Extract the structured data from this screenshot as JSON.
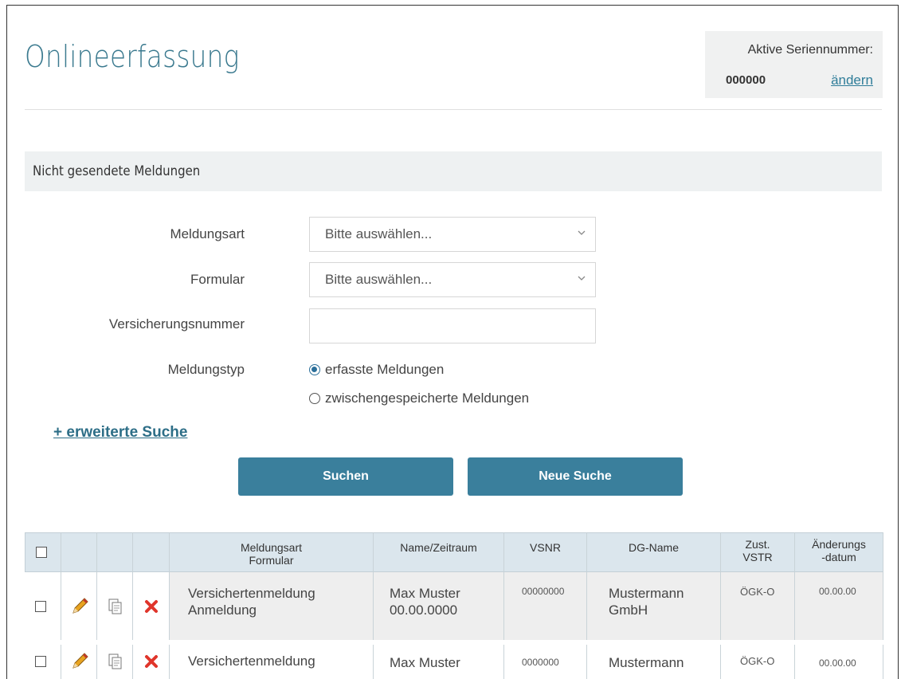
{
  "header": {
    "title": "Onlineerfassung",
    "serial_label": "Aktive Seriennummer:",
    "serial_value": "000000",
    "serial_change": "ändern"
  },
  "section": {
    "title": "Nicht gesendete Meldungen"
  },
  "form": {
    "meldungsart_label": "Meldungsart",
    "meldungsart_value": "Bitte auswählen...",
    "formular_label": "Formular",
    "formular_value": "Bitte auswählen...",
    "versicherungsnummer_label": "Versicherungsnummer",
    "versicherungsnummer_value": "",
    "meldungstyp_label": "Meldungstyp",
    "radio_options": [
      {
        "label": "erfasste Meldungen",
        "checked": true
      },
      {
        "label": "zwischengespeicherte Meldungen",
        "checked": false
      }
    ],
    "extended_search": "+ erweiterte Suche",
    "search_button": "Suchen",
    "new_search_button": "Neue Suche"
  },
  "table": {
    "columns": {
      "meldungsart_line1": "Meldungsart",
      "meldungsart_line2": "Formular",
      "name": "Name/Zeitraum",
      "vsnr": "VSNR",
      "dg_name": "DG-Name",
      "zust_line1": "Zust.",
      "zust_line2": "VSTR",
      "date_line1": "Änderungs",
      "date_line2": "-datum"
    },
    "rows": [
      {
        "meldungsart": "Versichertenmeldung",
        "formular": "Anmeldung",
        "name": "Max Muster",
        "zeitraum": "00.00.0000",
        "vsnr": "00000000",
        "dg_name_line1": "Mustermann",
        "dg_name_line2": "GmbH",
        "zust": "ÖGK-O",
        "datum": "00.00.00"
      },
      {
        "meldungsart": "Versichertenmeldung",
        "formular": "",
        "name": "Max Muster",
        "zeitraum": "",
        "vsnr": "0000000",
        "dg_name_line1": "Mustermann",
        "dg_name_line2": "",
        "zust": "ÖGK-O",
        "datum": "00.00.00"
      }
    ]
  },
  "colors": {
    "accent": "#3a7f9c",
    "title": "#3b7a8f",
    "delete": "#e0352b"
  }
}
